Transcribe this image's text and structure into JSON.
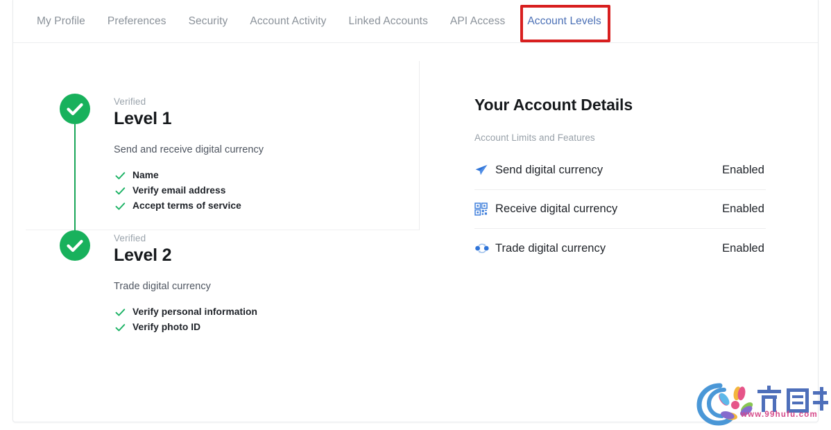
{
  "tabs": [
    {
      "label": "My Profile",
      "active": false
    },
    {
      "label": "Preferences",
      "active": false
    },
    {
      "label": "Security",
      "active": false
    },
    {
      "label": "Account Activity",
      "active": false
    },
    {
      "label": "Linked Accounts",
      "active": false
    },
    {
      "label": "API Access",
      "active": false
    },
    {
      "label": "Account Levels",
      "active": true
    }
  ],
  "annotation": {
    "target": "Account Levels",
    "color": "#d81f1f"
  },
  "levels": [
    {
      "status": "Verified",
      "title": "Level 1",
      "description": "Send and receive digital currency",
      "badge_icon": "check-circle-icon",
      "requirements": [
        "Name",
        "Verify email address",
        "Accept terms of service"
      ]
    },
    {
      "status": "Verified",
      "title": "Level 2",
      "description": "Trade digital currency",
      "badge_icon": "check-circle-icon",
      "requirements": [
        "Verify personal information",
        "Verify photo ID"
      ]
    }
  ],
  "details": {
    "title": "Your Account Details",
    "subtitle": "Account Limits and Features",
    "features": [
      {
        "icon": "send-paper-plane-icon",
        "label": "Send digital currency",
        "value": "Enabled"
      },
      {
        "icon": "qr-code-icon",
        "label": "Receive digital currency",
        "value": "Enabled"
      },
      {
        "icon": "trade-exchange-icon",
        "label": "Trade digital currency",
        "value": "Enabled"
      }
    ]
  },
  "watermark": {
    "url": "www.99hufu.com",
    "logo_icon": "hufu-flower-logo"
  },
  "colors": {
    "verified_green": "#18b15c",
    "connector_green": "#18a558",
    "active_tab_blue": "#4a6fb5",
    "tab_underline": "#3f5d9e",
    "icon_blue": "#2f6fd0",
    "annotation_red": "#d81f1f"
  }
}
